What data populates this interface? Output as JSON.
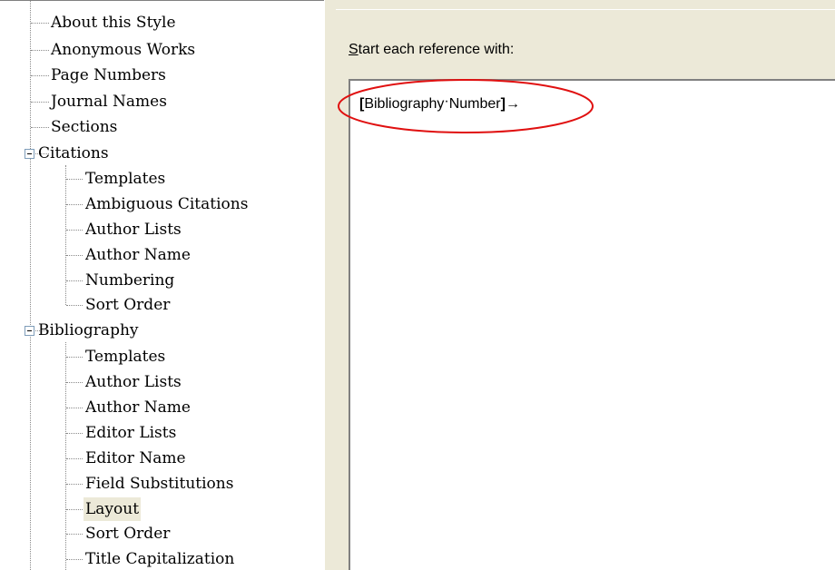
{
  "tree": {
    "top_items": [
      "About this Style",
      "Anonymous Works",
      "Page Numbers",
      "Journal Names",
      "Sections"
    ],
    "groups": [
      {
        "label": "Citations",
        "children": [
          "Templates",
          "Ambiguous Citations",
          "Author Lists",
          "Author Name",
          "Numbering",
          "Sort Order"
        ]
      },
      {
        "label": "Bibliography",
        "children": [
          "Templates",
          "Author Lists",
          "Author Name",
          "Editor Lists",
          "Editor Name",
          "Field Substitutions",
          "Layout",
          "Sort Order",
          "Title Capitalization"
        ]
      }
    ],
    "selected": "Layout"
  },
  "panel": {
    "label_accel": "S",
    "label_rest": "tart each reference with:",
    "field_open_bracket": "[",
    "field_text": "Bibliography",
    "field_separator": "·",
    "field_text2": "Number",
    "field_close_bracket": "]",
    "tab_marker": "→"
  },
  "colors": {
    "panel_bg": "#ece9d8",
    "annotation_ellipse": "#e01010",
    "selection_bg": "#ece9d8"
  }
}
